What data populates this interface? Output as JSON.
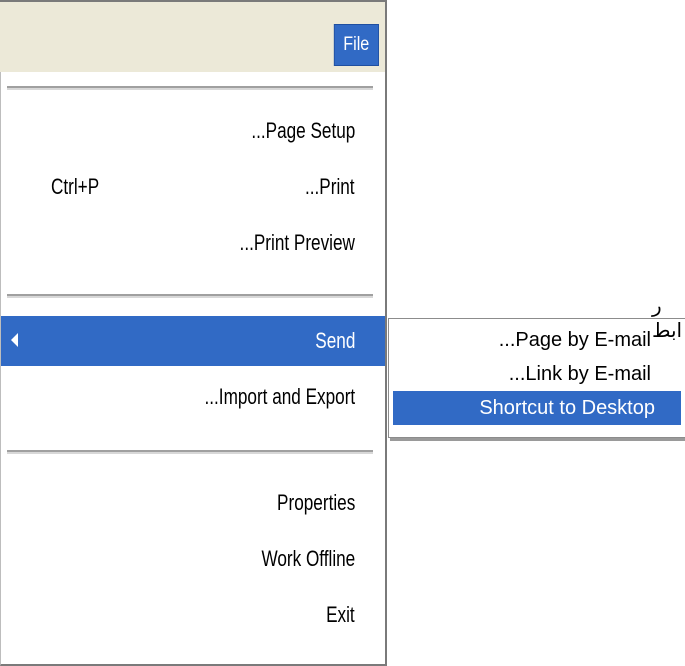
{
  "menubar": {
    "file_label": "File"
  },
  "menu": {
    "page_setup": "...Page Setup",
    "print": "...Print",
    "print_shortcut": "Ctrl+P",
    "print_preview": "...Print Preview",
    "send": "Send",
    "import_export": "...Import and Export",
    "properties": "Properties",
    "work_offline": "Work Offline",
    "exit": "Exit"
  },
  "submenu": {
    "page_by_email": "...Page by E-mail",
    "link_by_email": "...Link by E-mail",
    "shortcut_to_desktop": "Shortcut to Desktop"
  },
  "background_text": "ر ابط",
  "colors": {
    "highlight": "#316ac5",
    "menu_bg": "#ffffff",
    "bar_bg": "#ece9d8"
  },
  "icons": {
    "send_submenu": "chevron-left-icon"
  }
}
